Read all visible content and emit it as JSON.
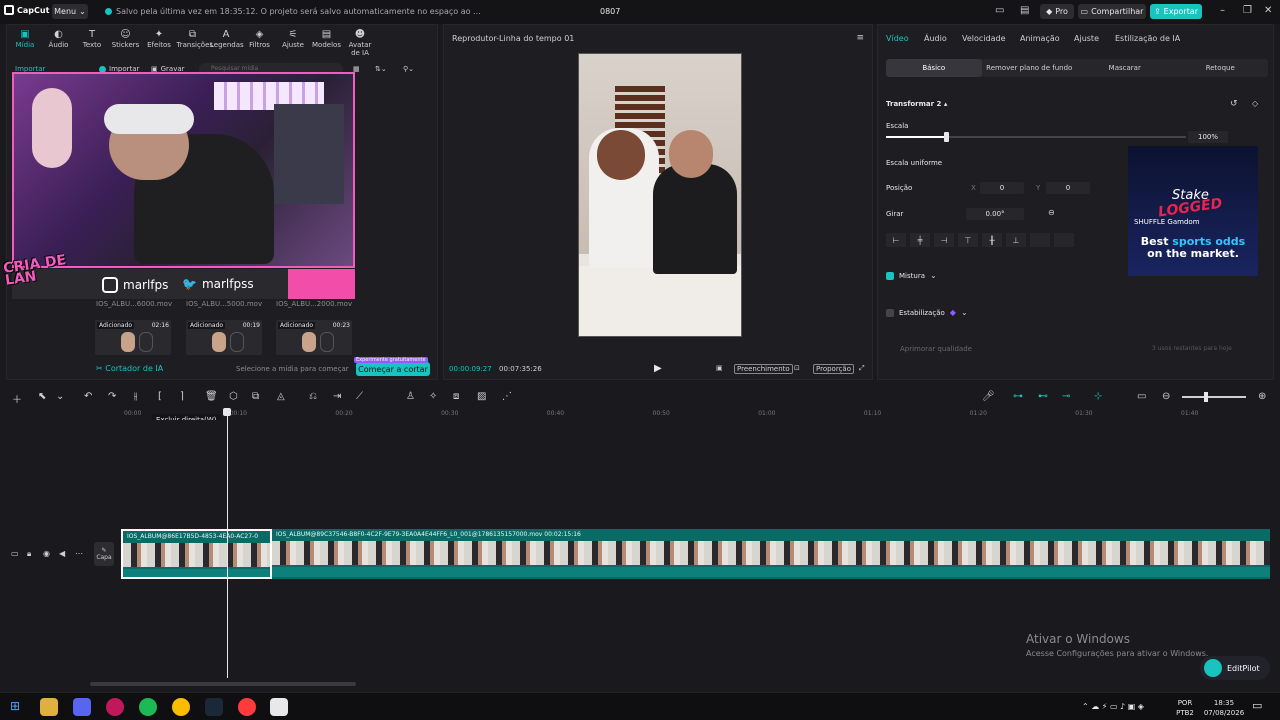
{
  "app": {
    "logo_text": "CapCut",
    "menu_label": "Menu",
    "save_status": "Salvo pela última vez em 18:35:12. O projeto será salvo automaticamente no espaço ao ...",
    "project_title": "0807",
    "pro_label": "Pro",
    "share_label": "Compartilhar",
    "export_label": "Exportar"
  },
  "media_tabs": [
    {
      "icon": "▣",
      "label": "Mídia"
    },
    {
      "icon": "◐",
      "label": "Áudio"
    },
    {
      "icon": "T",
      "label": "Texto"
    },
    {
      "icon": "☺",
      "label": "Stickers"
    },
    {
      "icon": "✦",
      "label": "Efeitos"
    },
    {
      "icon": "⧉",
      "label": "Transições"
    },
    {
      "icon": "A",
      "label": "Legendas"
    },
    {
      "icon": "◈",
      "label": "Filtros"
    },
    {
      "icon": "⚟",
      "label": "Ajuste"
    },
    {
      "icon": "▤",
      "label": "Modelos"
    },
    {
      "icon": "☻",
      "label": "Avatar de IA"
    }
  ],
  "media_toolbar": {
    "import_label": "Importar",
    "import_btn": "Importar",
    "record_btn": "Gravar",
    "search_placeholder": "Pesquisar mídia"
  },
  "overlay": {
    "instagram": "marlfps",
    "twitter": "marlfpss",
    "brand": "CRIA DE LAN"
  },
  "media_items": [
    {
      "name": "IOS_ALBU...6000.mov",
      "tag": "Adicionado",
      "duration": "02:16"
    },
    {
      "name": "IOS_ALBU...5000.mov",
      "tag": "Adicionado",
      "duration": "00:19"
    },
    {
      "name": "IOS_ALBU...2000.mov",
      "tag": "Adicionado",
      "duration": "00:23"
    }
  ],
  "ai_cutter": {
    "label": "Cortador de IA",
    "hint": "Selecione a mídia para começar",
    "button": "Começar a cortar",
    "badge": "Experimente gratuitamente"
  },
  "player": {
    "title": "Reprodutor-Linha do tempo 01",
    "current_time": "00:00:09:27",
    "total_time": "00:07:35:26",
    "fill_label": "Preenchimento",
    "ratio_label": "Proporção"
  },
  "inspector": {
    "tabs": [
      "Vídeo",
      "Áudio",
      "Velocidade",
      "Animação",
      "Ajuste",
      "Estilização de IA"
    ],
    "segments": [
      "Básico",
      "Remover plano de fundo",
      "Mascarar",
      "Retoque"
    ],
    "transform_label": "Transformar 2",
    "scale_label": "Escala",
    "scale_value": "100%",
    "scale_fraction": 0.2,
    "uniform_label": "Escala uniforme",
    "position_label": "Posição",
    "pos_x_label": "X",
    "pos_x": "0",
    "pos_y_label": "Y",
    "pos_y": "0",
    "rotate_label": "Girar",
    "rotate_value": "0.00°",
    "blend_label": "Mistura",
    "stabilize_label": "Estabilização",
    "enhance_label": "Aprimorar qualidade",
    "enhance_hint": "3 usos restantes para hoje"
  },
  "ad": {
    "brand": "Stake",
    "logo": "LOGGED",
    "partners": "SHUFFLE  Gamdom",
    "text_a": "Best",
    "text_b": "sports odds",
    "text_c": "on the market."
  },
  "timeline": {
    "tooltip": "Excluir direita(W)",
    "ticks": [
      "00:00",
      "00:10",
      "00:20",
      "00:30",
      "00:40",
      "00:50",
      "01:00",
      "01:10",
      "01:20",
      "01:30",
      "01:40"
    ],
    "cover_label": "Capa",
    "clip1_label": "IOS_ALBUM@86E17B5D-4853-4EA0-AC27-0",
    "clip2_label": "IOS_ALBUM@89C37546-B8F0-4C2F-9E79-3EA0A4E44FF6_L0_001@1786135157000.mov",
    "clip2_duration": "00:02:15:16"
  },
  "watermark": {
    "line1": "Ativar o Windows",
    "line2": "Acesse Configurações para ativar o Windows."
  },
  "editpilot": "EditPilot",
  "tray": {
    "lang1": "POR",
    "lang2": "PTB2",
    "time": "18:35",
    "date": "07/08/2026"
  },
  "colors": {
    "accent": "#19c3c0",
    "overlay_pink": "#f25cbe",
    "clip": "#0b6a66",
    "background": "#1a1a1e"
  }
}
